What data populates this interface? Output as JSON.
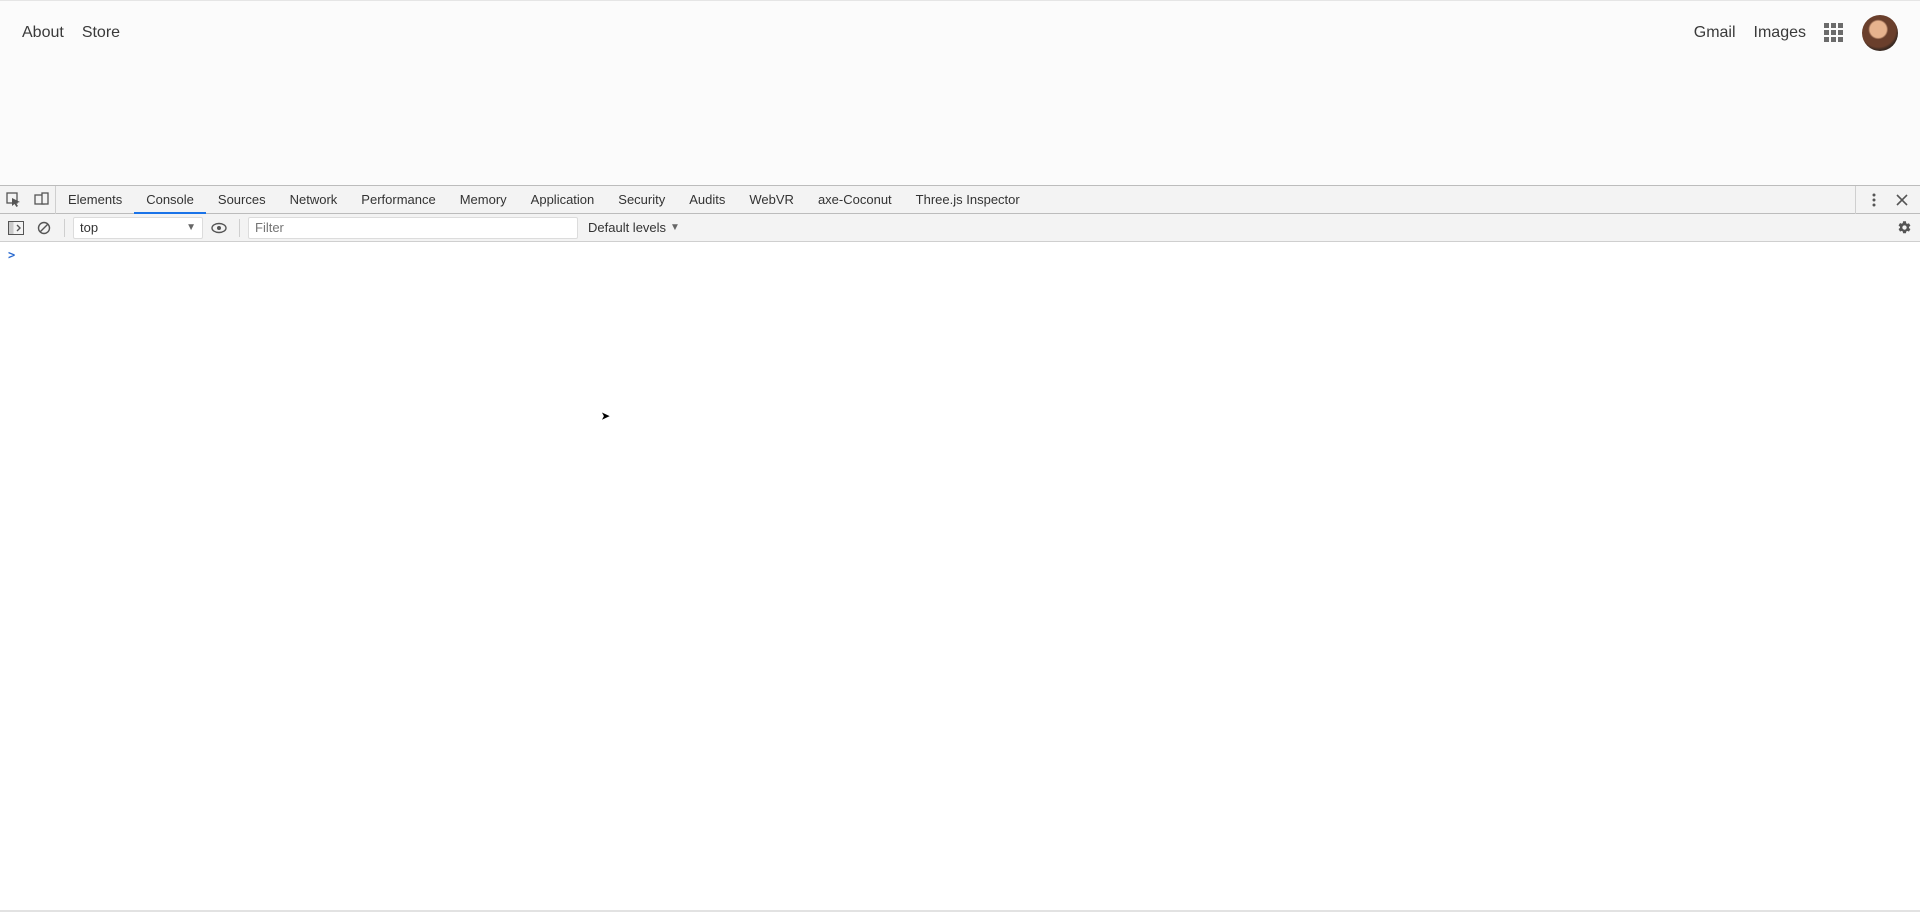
{
  "header": {
    "left_links": [
      "About",
      "Store"
    ],
    "right_links": [
      "Gmail",
      "Images"
    ]
  },
  "devtools": {
    "tabs": [
      "Elements",
      "Console",
      "Sources",
      "Network",
      "Performance",
      "Memory",
      "Application",
      "Security",
      "Audits",
      "WebVR",
      "axe-Coconut",
      "Three.js Inspector"
    ],
    "active_tab_index": 1,
    "console_bar": {
      "context": "top",
      "filter_placeholder": "Filter",
      "levels_label": "Default levels"
    },
    "prompt": ">"
  }
}
